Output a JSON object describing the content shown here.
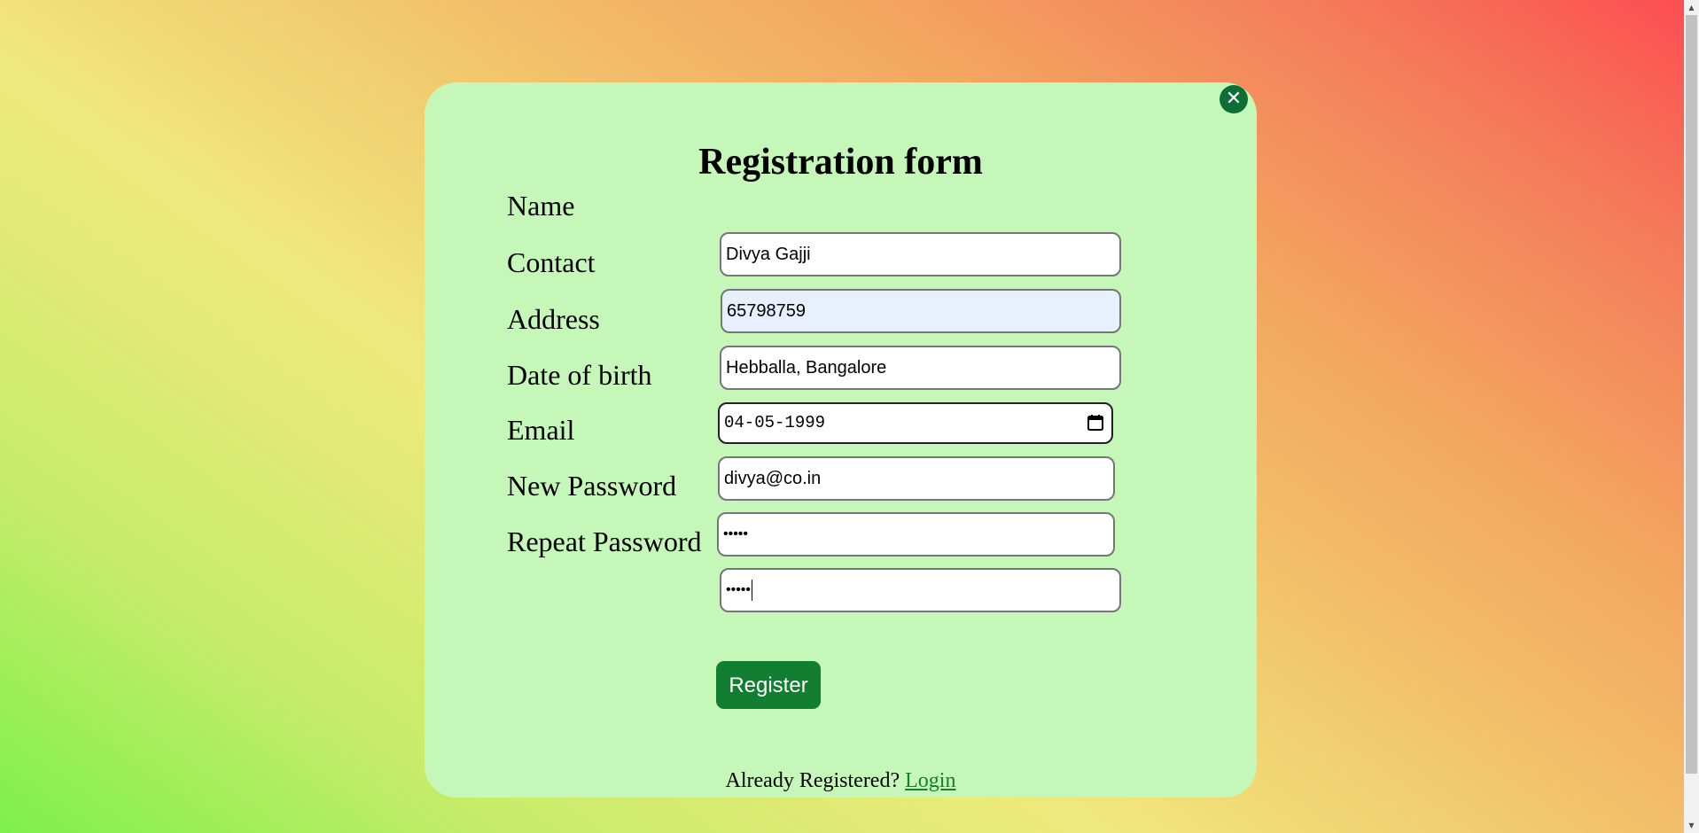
{
  "form": {
    "title": "Registration form",
    "close_icon": "close-icon",
    "fields": {
      "name": {
        "label": "Name",
        "value": "Divya Gajji"
      },
      "contact": {
        "label": "Contact",
        "value": "65798759"
      },
      "address": {
        "label": "Address",
        "value": "Hebballa, Bangalore"
      },
      "dob": {
        "label": "Date of birth",
        "value": "04-05-1999",
        "icon": "calendar-icon"
      },
      "email": {
        "label": "Email",
        "value": "divya@co.in"
      },
      "new_password": {
        "label": "New Password",
        "value": "•••••"
      },
      "repeat_password": {
        "label": "Repeat Password",
        "value": "•••••"
      }
    },
    "register_label": "Register",
    "footer_text": "Already Registered?",
    "login_link": "Login"
  },
  "colors": {
    "card_bg": "#c5f7b9",
    "accent": "#117e31",
    "close_bg": "#0f6e35",
    "focused_field_bg": "#e8f0fe"
  }
}
